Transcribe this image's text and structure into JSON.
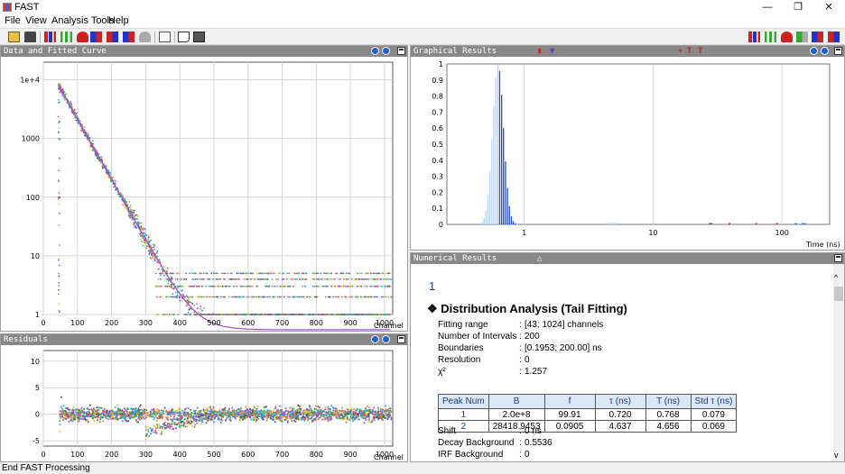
{
  "window": {
    "title": "FAST",
    "min": "—",
    "max": "❐",
    "close": "✕"
  },
  "menu": [
    "File",
    "View",
    "Analysis Tools",
    "Help"
  ],
  "toolbar_icons": [
    "open-folder-icon",
    "delete-icon",
    "bar-chart-icon",
    "line-bars-icon",
    "stack-icon",
    "distribution-icon",
    "red-bars-icon",
    "blue-bars-icon",
    "gray-stack-icon",
    "document-icon",
    "print-preview-icon",
    "print-icon"
  ],
  "toolbar_right_icons": [
    "bar-chart-icon",
    "line-bars-icon",
    "stack-icon",
    "distribution-icon",
    "red-bars-icon",
    "blue-bars-icon"
  ],
  "panels": {
    "data": {
      "title": "Data and Fitted Curve",
      "xlabel": "Channel",
      "yticks": [
        "1e+4",
        "1000",
        "100",
        "10",
        "1"
      ],
      "xticks": [
        "0",
        "100",
        "200",
        "300",
        "400",
        "500",
        "600",
        "700",
        "800",
        "900",
        "1000"
      ]
    },
    "residuals": {
      "title": "Residuals",
      "xlabel": "Channel",
      "yticks": [
        "10",
        "5",
        "0",
        "-5"
      ],
      "xticks": [
        "0",
        "100",
        "200",
        "300",
        "400",
        "500",
        "600",
        "700",
        "800",
        "900",
        "1000"
      ]
    },
    "graphical": {
      "title": "Graphical Results",
      "xlabel": "Time (ns)",
      "yticks": [
        "1",
        "0.9",
        "0.8",
        "0.7",
        "0.6",
        "0.5",
        "0.4",
        "0.3",
        "0.2",
        "0.1",
        "0"
      ],
      "xticks": [
        "1",
        "10",
        "100"
      ]
    },
    "numerical": {
      "title": "Numerical Results"
    }
  },
  "numerical": {
    "index": "1",
    "heading": "Distribution Analysis (Tail Fitting)",
    "params": [
      {
        "k": "Fitting range",
        "v": "[43; 1024] channels"
      },
      {
        "k": "Number of Intervals",
        "v": "200"
      },
      {
        "k": "Boundaries",
        "v": "[0.1953; 200.00] ns"
      },
      {
        "k": "Resolution",
        "v": "0"
      },
      {
        "k": "χ²",
        "v": "1.257"
      }
    ],
    "table": {
      "headers": [
        "Peak Num",
        "B",
        "f",
        "τ (ns)",
        "T (ns)",
        "Std τ (ns)"
      ],
      "rows": [
        [
          "1",
          "2.0e+8",
          "99.91",
          "0.720",
          "0.768",
          "0.079"
        ],
        [
          "2",
          "28418.9453",
          "0.0905",
          "4.637",
          "4.656",
          "0.069"
        ]
      ]
    },
    "extra": [
      {
        "k": "Shift",
        "v": "0 ns"
      },
      {
        "k": "Decay Background",
        "v": "0.5536"
      },
      {
        "k": "IRF Background",
        "v": "0"
      }
    ]
  },
  "status": "End FAST Processing",
  "colors": {
    "panel_header": "#888888",
    "accent": "#1a3a8a",
    "table_header": "#dce6f4"
  }
}
